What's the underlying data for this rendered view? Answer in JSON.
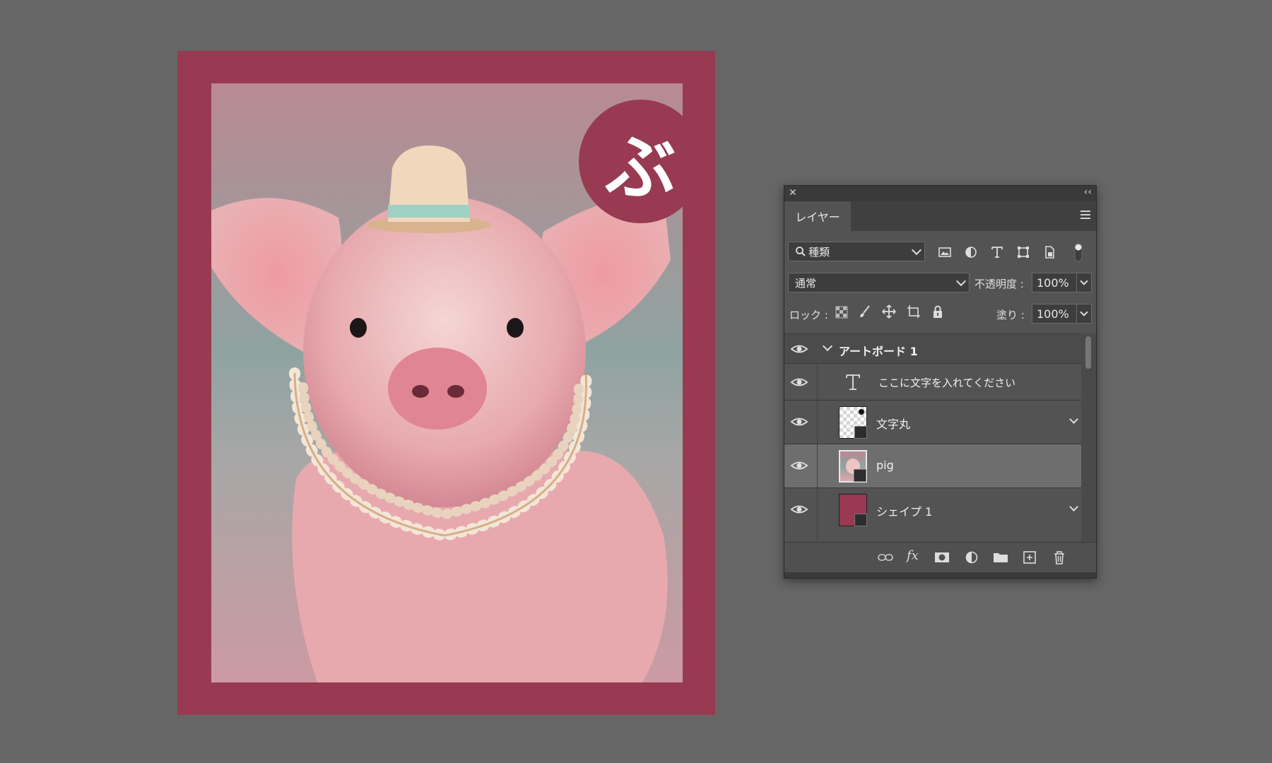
{
  "artboard": {
    "border_color": "#973a52",
    "badge_text": "ぶ",
    "image": "pig wearing a small cream hat and a pearl necklace"
  },
  "panel": {
    "close_icon": "close-icon",
    "collapse_icon": "double-chevron-left-icon",
    "tab_label": "レイヤー",
    "filter": {
      "label": "種類",
      "icons": [
        "image-filter-icon",
        "adjustment-filter-icon",
        "type-filter-icon",
        "shape-filter-icon",
        "smart-object-filter-icon",
        "filter-toggle-icon"
      ]
    },
    "blend_mode": "通常",
    "opacity_label": "不透明度 :",
    "opacity_value": "100%",
    "lock_label": "ロック :",
    "lock_icons": [
      "lock-transparency-icon",
      "lock-image-icon",
      "lock-position-icon",
      "lock-artboard-icon",
      "lock-all-icon"
    ],
    "fill_label": "塗り :",
    "fill_value": "100%",
    "layers": [
      {
        "name": "アートボード 1",
        "type": "artboard",
        "visible": true
      },
      {
        "name": "ここに文字を入れてください",
        "type": "text",
        "visible": true
      },
      {
        "name": "文字丸",
        "type": "shape",
        "visible": true
      },
      {
        "name": "pig",
        "type": "smart-object",
        "visible": true,
        "selected": true
      },
      {
        "name": "シェイプ 1",
        "type": "shape",
        "visible": true
      }
    ],
    "footer_icons": [
      "link-layers-icon",
      "fx-icon",
      "layer-mask-icon",
      "adjustment-layer-icon",
      "new-group-icon",
      "new-layer-icon",
      "trash-icon"
    ],
    "fx_label": "fx"
  },
  "colors": {
    "workspace": "#666666",
    "panel": "#535353",
    "selected_row": "#6e6e6e",
    "accent_maroon": "#973a52"
  }
}
